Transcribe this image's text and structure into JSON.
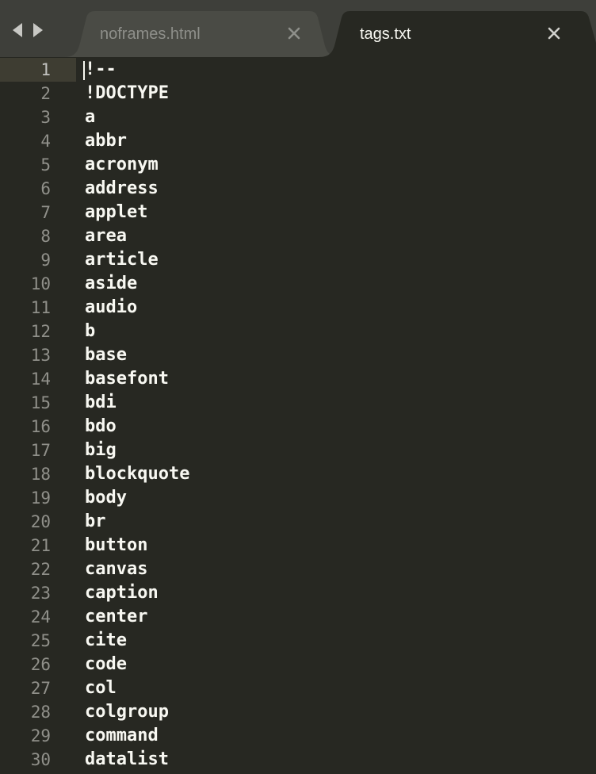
{
  "tabs": [
    {
      "label": "noframes.html",
      "active": false,
      "close_icon": "close-icon"
    },
    {
      "label": "tags.txt",
      "active": true,
      "close_icon": "close-icon"
    }
  ],
  "navigation": {
    "back_icon": "arrow-left-icon",
    "forward_icon": "arrow-right-icon"
  },
  "editor": {
    "current_line": 1,
    "lines": [
      {
        "number": "1",
        "text": "!--"
      },
      {
        "number": "2",
        "text": "!DOCTYPE"
      },
      {
        "number": "3",
        "text": "a"
      },
      {
        "number": "4",
        "text": "abbr"
      },
      {
        "number": "5",
        "text": "acronym"
      },
      {
        "number": "6",
        "text": "address"
      },
      {
        "number": "7",
        "text": "applet"
      },
      {
        "number": "8",
        "text": "area"
      },
      {
        "number": "9",
        "text": "article"
      },
      {
        "number": "10",
        "text": "aside"
      },
      {
        "number": "11",
        "text": "audio"
      },
      {
        "number": "12",
        "text": "b"
      },
      {
        "number": "13",
        "text": "base"
      },
      {
        "number": "14",
        "text": "basefont"
      },
      {
        "number": "15",
        "text": "bdi"
      },
      {
        "number": "16",
        "text": "bdo"
      },
      {
        "number": "17",
        "text": "big"
      },
      {
        "number": "18",
        "text": "blockquote"
      },
      {
        "number": "19",
        "text": "body"
      },
      {
        "number": "20",
        "text": "br"
      },
      {
        "number": "21",
        "text": "button"
      },
      {
        "number": "22",
        "text": "canvas"
      },
      {
        "number": "23",
        "text": "caption"
      },
      {
        "number": "24",
        "text": "center"
      },
      {
        "number": "25",
        "text": "cite"
      },
      {
        "number": "26",
        "text": "code"
      },
      {
        "number": "27",
        "text": "col"
      },
      {
        "number": "28",
        "text": "colgroup"
      },
      {
        "number": "29",
        "text": "command"
      },
      {
        "number": "30",
        "text": "datalist"
      }
    ]
  },
  "colors": {
    "background": "#272822",
    "tab_bar": "#3e3f3a",
    "inactive_tab": "#4a4b45",
    "text": "#f8f8f2",
    "line_number": "#90908a"
  }
}
